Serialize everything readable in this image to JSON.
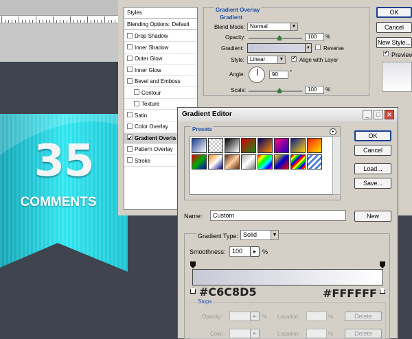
{
  "canvas": {
    "ribbon_big_text": "35",
    "ribbon_small_text": "COMMENTS"
  },
  "layer_style": {
    "styles_header": "Styles",
    "blending_options": "Blending Options: Default",
    "effects": [
      {
        "label": "Drop Shadow",
        "checked": false,
        "sub": false
      },
      {
        "label": "Inner Shadow",
        "checked": false,
        "sub": false
      },
      {
        "label": "Outer Glow",
        "checked": false,
        "sub": false
      },
      {
        "label": "Inner Glow",
        "checked": false,
        "sub": false
      },
      {
        "label": "Bevel and Emboss",
        "checked": false,
        "sub": false
      },
      {
        "label": "Contour",
        "checked": false,
        "sub": true
      },
      {
        "label": "Texture",
        "checked": false,
        "sub": true
      },
      {
        "label": "Satin",
        "checked": false,
        "sub": false
      },
      {
        "label": "Color Overlay",
        "checked": false,
        "sub": false
      },
      {
        "label": "Gradient Overla",
        "checked": true,
        "sub": false,
        "selected": true
      },
      {
        "label": "Pattern Overlay",
        "checked": false,
        "sub": false
      },
      {
        "label": "Stroke",
        "checked": false,
        "sub": false
      }
    ],
    "panel_title": "Gradient Overlay",
    "group_title": "Gradient",
    "blend_mode_label": "Blend Mode:",
    "blend_mode_value": "Normal",
    "opacity_label": "Opacity:",
    "opacity_value": "100",
    "opacity_percent": 100,
    "gradient_label": "Gradient:",
    "reverse_label": "Reverse",
    "style_label": "Style:",
    "style_value": "Linear",
    "align_label": "Align with Layer",
    "angle_label": "Angle:",
    "angle_value": "90",
    "degree_symbol": "°",
    "scale_label": "Scale:",
    "scale_value": "100",
    "scale_percent": 100,
    "percent_symbol": "%",
    "ok_label": "OK",
    "cancel_label": "Cancel",
    "new_style_label": "New Style...",
    "preview_label": "Preview"
  },
  "gradient_editor": {
    "title": "Gradient Editor",
    "minimize_glyph": "_",
    "maximize_glyph": "□",
    "close_glyph": "✕",
    "presets_label": "Presets",
    "presets_menu_glyph": "▸",
    "ok_label": "OK",
    "cancel_label": "Cancel",
    "load_label": "Load...",
    "save_label": "Save...",
    "name_label": "Name:",
    "name_value": "Custom",
    "new_label": "New",
    "gradient_type_label": "Gradient Type:",
    "gradient_type_value": "Solid",
    "smoothness_label": "Smoothness:",
    "smoothness_value": "100",
    "smoothness_arrow": "▸",
    "percent_symbol": "%",
    "start_color": "#C6C8D5",
    "end_color": "#FFFFFF",
    "stops_label": "Stops",
    "opacity_label": "Opacity:",
    "color_label": "Color:",
    "location_label": "Location:",
    "delete_label": "Delete"
  },
  "colors": {
    "ribbon_light": "#2fe6f0",
    "ribbon_dark": "#0f8aa0",
    "accent_blue": "#1d4ea8"
  }
}
